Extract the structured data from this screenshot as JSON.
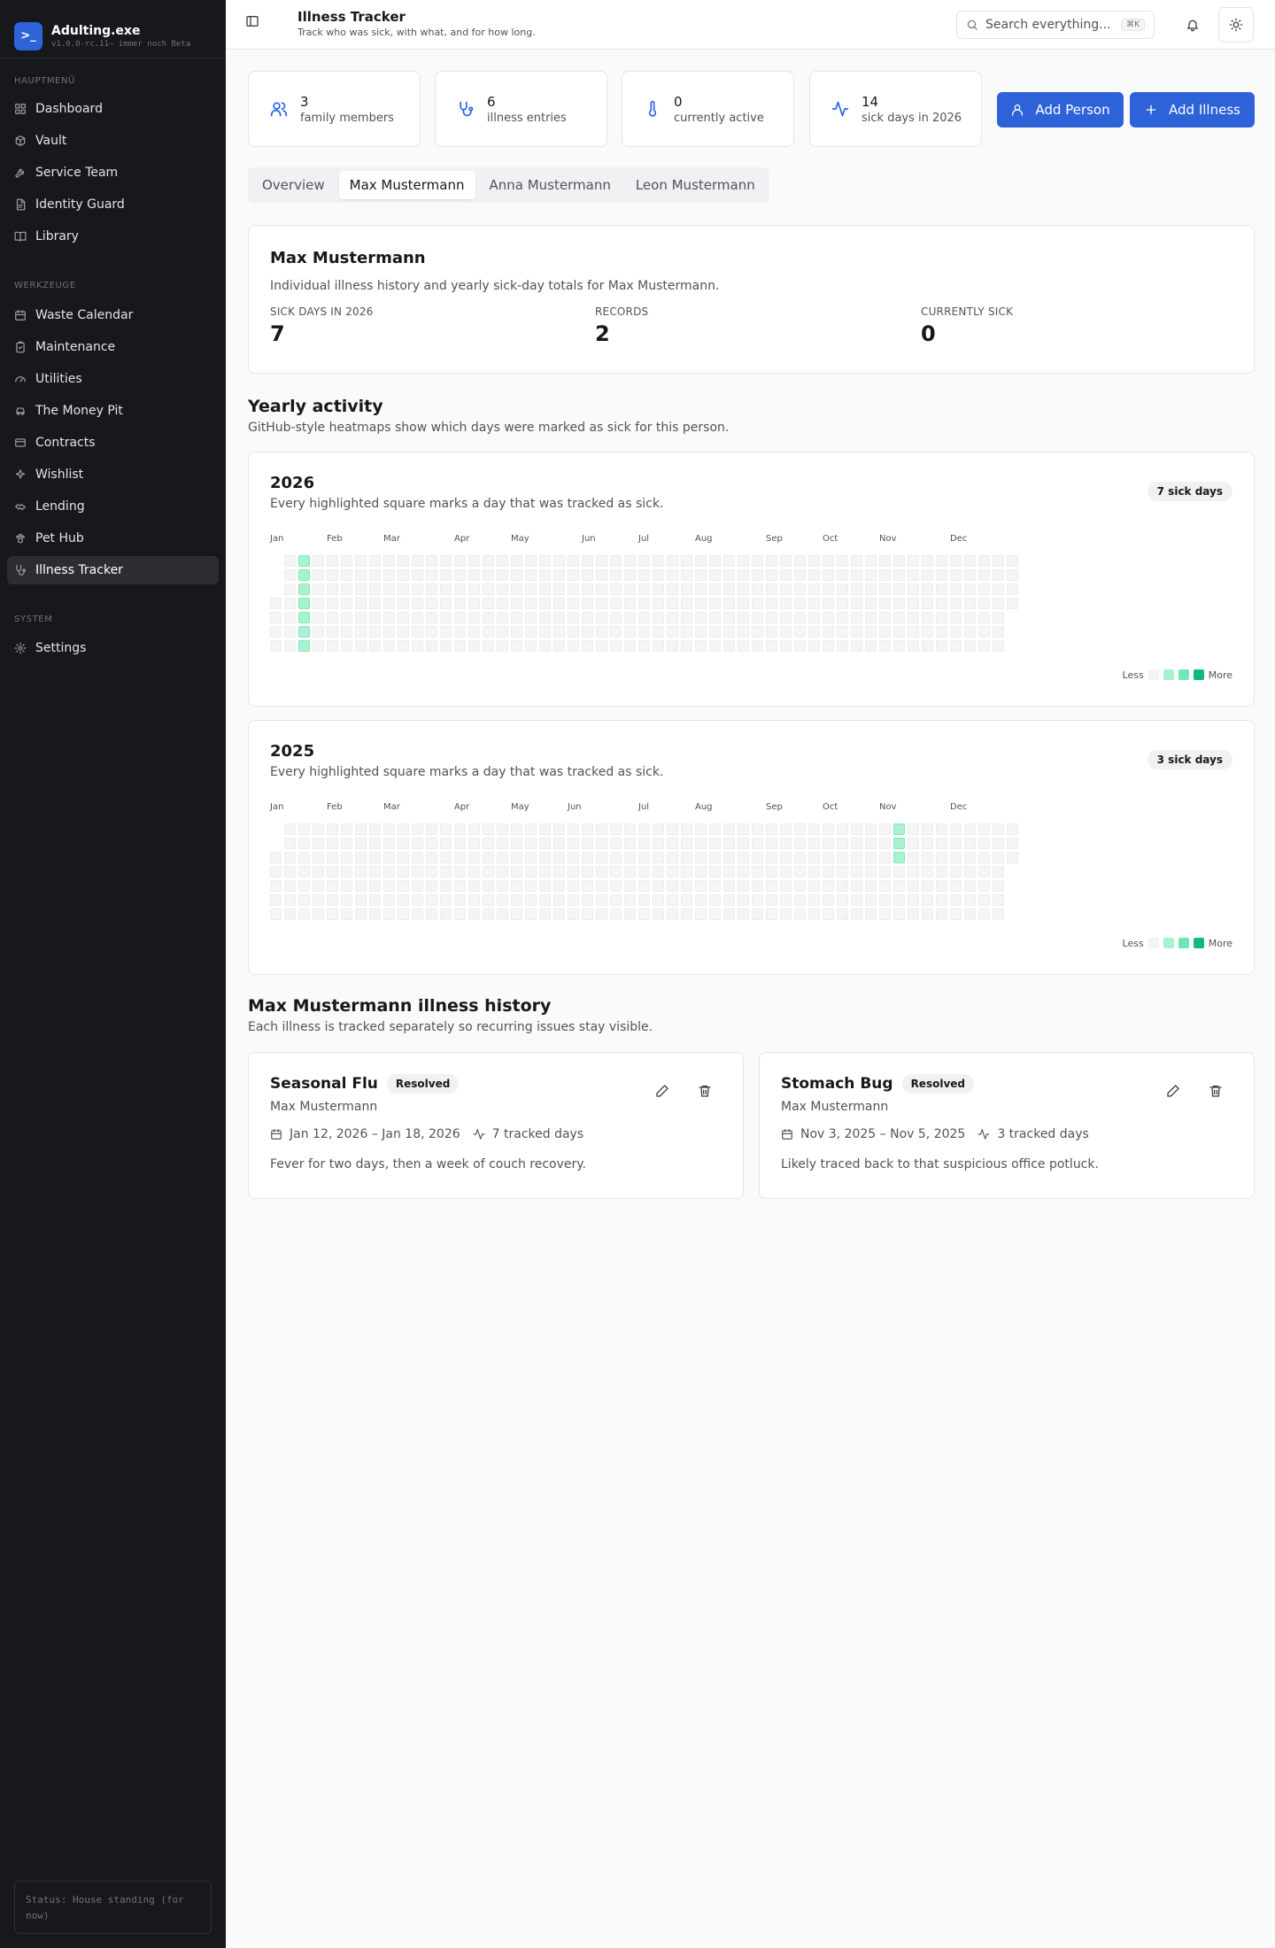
{
  "app": {
    "name": "Adulting.exe",
    "version": "v1.0.0-rc.11– immer noch Beta",
    "logo_glyph": ">_"
  },
  "sidebar": {
    "section_main": "HAUPTMENÜ",
    "main_items": [
      {
        "label": "Dashboard",
        "icon": "dashboard-icon"
      },
      {
        "label": "Vault",
        "icon": "vault-icon"
      },
      {
        "label": "Service Team",
        "icon": "wrench-icon"
      },
      {
        "label": "Identity Guard",
        "icon": "id-card-icon"
      },
      {
        "label": "Library",
        "icon": "book-icon"
      }
    ],
    "section_tools": "WERKZEUGE",
    "tool_items": [
      {
        "label": "Waste Calendar",
        "icon": "calendar-icon"
      },
      {
        "label": "Maintenance",
        "icon": "clipboard-icon"
      },
      {
        "label": "Utilities",
        "icon": "gauge-icon"
      },
      {
        "label": "The Money Pit",
        "icon": "car-icon"
      },
      {
        "label": "Contracts",
        "icon": "wallet-icon"
      },
      {
        "label": "Wishlist",
        "icon": "sparkle-icon"
      },
      {
        "label": "Lending",
        "icon": "handshake-icon"
      },
      {
        "label": "Pet Hub",
        "icon": "paw-icon"
      },
      {
        "label": "Illness Tracker",
        "icon": "stethoscope-icon",
        "active": true
      }
    ],
    "section_system": "SYSTEM",
    "system_items": [
      {
        "label": "Settings",
        "icon": "gear-icon"
      }
    ],
    "status": "Status: House standing (for now)"
  },
  "header": {
    "title": "Illness Tracker",
    "subtitle": "Track who was sick, with what, and for how long.",
    "search_placeholder": "Search everything...",
    "search_shortcut": "⌘K"
  },
  "stats": [
    {
      "value": "3",
      "label": "family members",
      "icon": "users-icon"
    },
    {
      "value": "6",
      "label": "illness entries",
      "icon": "stethoscope-icon"
    },
    {
      "value": "0",
      "label": "currently active",
      "icon": "thermometer-icon"
    },
    {
      "value": "14",
      "label": "sick days in 2026",
      "icon": "activity-icon"
    }
  ],
  "actions": {
    "add_person": "Add Person",
    "add_illness": "Add Illness"
  },
  "tabs": [
    {
      "label": "Overview"
    },
    {
      "label": "Max Mustermann",
      "active": true
    },
    {
      "label": "Anna Mustermann"
    },
    {
      "label": "Leon Mustermann"
    }
  ],
  "person": {
    "name": "Max Mustermann",
    "description": "Individual illness history and yearly sick-day totals for Max Mustermann.",
    "kpis": [
      {
        "label": "SICK DAYS IN 2026",
        "value": "7"
      },
      {
        "label": "RECORDS",
        "value": "2"
      },
      {
        "label": "CURRENTLY SICK",
        "value": "0"
      }
    ]
  },
  "activity": {
    "title": "Yearly activity",
    "subtitle": "GitHub-style heatmaps show which days were marked as sick for this person.",
    "months": [
      "Jan",
      "Feb",
      "Mar",
      "Apr",
      "May",
      "Jun",
      "Jul",
      "Aug",
      "Sep",
      "Oct",
      "Nov",
      "Dec"
    ],
    "legend_less": "Less",
    "legend_more": "More",
    "legend_colors": [
      "#f4f4f5",
      "#a7f3d0",
      "#6ee7b7",
      "#10b981"
    ],
    "years": [
      {
        "year": "2026",
        "description": "Every highlighted square marks a day that was tracked as sick.",
        "pill": "7 sick days",
        "sick_from": "2026-01-12",
        "sick_to": "2026-01-18"
      },
      {
        "year": "2025",
        "description": "Every highlighted square marks a day that was tracked as sick.",
        "pill": "3 sick days",
        "sick_from": "2025-11-03",
        "sick_to": "2025-11-05"
      }
    ]
  },
  "history": {
    "title": "Max Mustermann illness history",
    "subtitle": "Each illness is tracked separately so recurring issues stay visible.",
    "items": [
      {
        "title": "Seasonal Flu",
        "status": "Resolved",
        "person": "Max Mustermann",
        "dates": "Jan 12, 2026 – Jan 18, 2026",
        "days": "7 tracked days",
        "note": "Fever for two days, then a week of couch recovery."
      },
      {
        "title": "Stomach Bug",
        "status": "Resolved",
        "person": "Max Mustermann",
        "dates": "Nov 3, 2025 – Nov 5, 2025",
        "days": "3 tracked days",
        "note": "Likely traced back to that suspicious office potluck."
      }
    ]
  }
}
